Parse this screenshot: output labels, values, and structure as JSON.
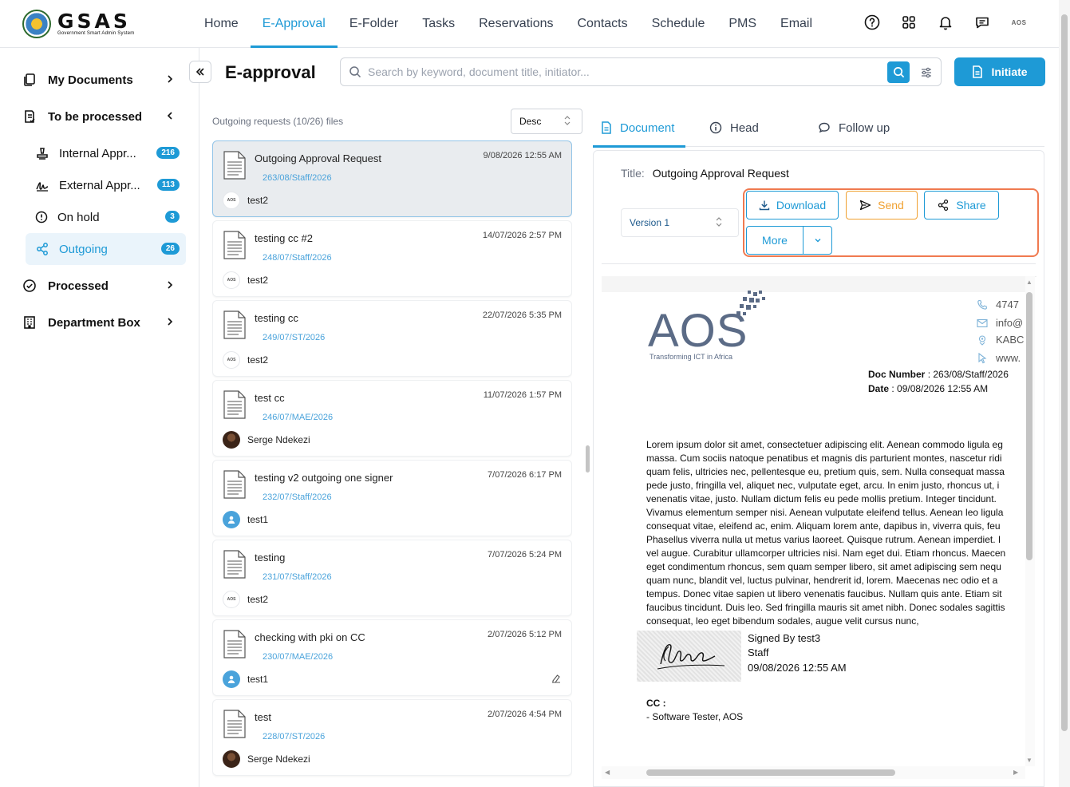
{
  "app": {
    "logo_main": "GSAS",
    "logo_sub": "Government Smart Admin System"
  },
  "nav": [
    "Home",
    "E-Approval",
    "E-Folder",
    "Tasks",
    "Reservations",
    "Contacts",
    "Schedule",
    "PMS",
    "Email"
  ],
  "nav_active": "E-Approval",
  "top_icons": [
    "help-icon",
    "apps-grid-icon",
    "bell-icon",
    "chat-icon"
  ],
  "profile_label": "AOS",
  "sidebar": {
    "my_documents": "My Documents",
    "to_be_processed": "To be processed",
    "sub": [
      {
        "label": "Internal Appr...",
        "count": "216"
      },
      {
        "label": "External Appr...",
        "count": "113"
      },
      {
        "label": "On hold",
        "count": "3"
      },
      {
        "label": "Outgoing",
        "count": "26"
      }
    ],
    "processed": "Processed",
    "department_box": "Department Box"
  },
  "page": {
    "title": "E-approval",
    "search_placeholder": "Search by keyword, document title, initiator...",
    "initiate_label": "Initiate"
  },
  "list": {
    "meta": "Outgoing requests (10/26) files",
    "sort": "Desc",
    "items": [
      {
        "title": "Outgoing Approval Request",
        "ref": "263/08/Staff/2026",
        "date": "9/08/2026 12:55 AM",
        "user": "test2",
        "avatar": "aos"
      },
      {
        "title": "testing cc #2",
        "ref": "248/07/Staff/2026",
        "date": "14/07/2026 2:57 PM",
        "user": "test2",
        "avatar": "aos"
      },
      {
        "title": "testing cc",
        "ref": "249/07/ST/2026",
        "date": "22/07/2026 5:35 PM",
        "user": "test2",
        "avatar": "aos"
      },
      {
        "title": "test cc",
        "ref": "246/07/MAE/2026",
        "date": "11/07/2026 1:57 PM",
        "user": "Serge Ndekezi",
        "avatar": "photo"
      },
      {
        "title": "testing v2 outgoing one signer",
        "ref": "232/07/Staff/2026",
        "date": "7/07/2026 6:17 PM",
        "user": "test1",
        "avatar": "user"
      },
      {
        "title": "testing",
        "ref": "231/07/Staff/2026",
        "date": "7/07/2026 5:24 PM",
        "user": "test2",
        "avatar": "aos"
      },
      {
        "title": "checking with pki on CC",
        "ref": "230/07/MAE/2026",
        "date": "2/07/2026 5:12 PM",
        "user": "test1",
        "avatar": "user"
      },
      {
        "title": "test",
        "ref": "228/07/ST/2026",
        "date": "2/07/2026 4:54 PM",
        "user": "Serge Ndekezi",
        "avatar": "photo"
      }
    ]
  },
  "tabs": [
    "Document",
    "Head",
    "Follow up"
  ],
  "detail": {
    "title_label": "Title:",
    "title_value": "Outgoing Approval Request",
    "version": "Version 1",
    "actions": {
      "download": "Download",
      "send": "Send",
      "share": "Share",
      "more": "More"
    }
  },
  "preview": {
    "logo_text": "AOS",
    "logo_tagline": "Transforming ICT in Africa",
    "contacts": [
      "4747",
      "info@",
      "KABC",
      "www."
    ],
    "doc_number_label": "Doc  Number",
    "doc_number": ": 263/08/Staff/2026",
    "date_label": "Date",
    "date_value": ": 09/08/2026 12:55 AM",
    "body_lines": [
      "Lorem ipsum dolor sit amet, consectetuer adipiscing elit. Aenean commodo ligula eg",
      "massa. Cum sociis natoque penatibus et magnis dis parturient montes, nascetur ridi",
      "quam felis, ultricies nec, pellentesque eu, pretium quis, sem. Nulla consequat massa",
      "pede justo, fringilla vel, aliquet nec, vulputate eget, arcu. In enim justo, rhoncus ut, i",
      "venenatis vitae, justo. Nullam dictum felis eu pede mollis pretium. Integer tincidunt.",
      "Vivamus elementum semper nisi. Aenean vulputate eleifend tellus. Aenean leo ligula",
      "consequat vitae, eleifend ac, enim. Aliquam lorem ante, dapibus in, viverra quis, feu",
      "Phasellus viverra nulla ut metus varius laoreet. Quisque rutrum. Aenean imperdiet. I",
      "vel augue. Curabitur ullamcorper ultricies nisi. Nam eget dui. Etiam rhoncus. Maecen",
      "eget condimentum rhoncus, sem quam semper libero, sit amet adipiscing sem nequ",
      "quam nunc, blandit vel, luctus pulvinar, hendrerit id, lorem. Maecenas nec odio et a",
      "tempus. Donec vitae sapien ut libero venenatis faucibus. Nullam quis ante. Etiam sit",
      "faucibus tincidunt. Duis leo. Sed fringilla mauris sit amet nibh. Donec sodales sagittis",
      "consequat, leo eget bibendum sodales, augue velit cursus nunc,"
    ],
    "signed_by": "Signed By  test3",
    "signer_role": "Staff",
    "signed_date": "09/08/2026 12:55 AM",
    "cc_label": "CC :",
    "cc_item": "-  Software Tester, AOS"
  },
  "colors": {
    "accent": "#1e9ad6",
    "send": "#f0a030",
    "highlight": "#f07a50"
  }
}
